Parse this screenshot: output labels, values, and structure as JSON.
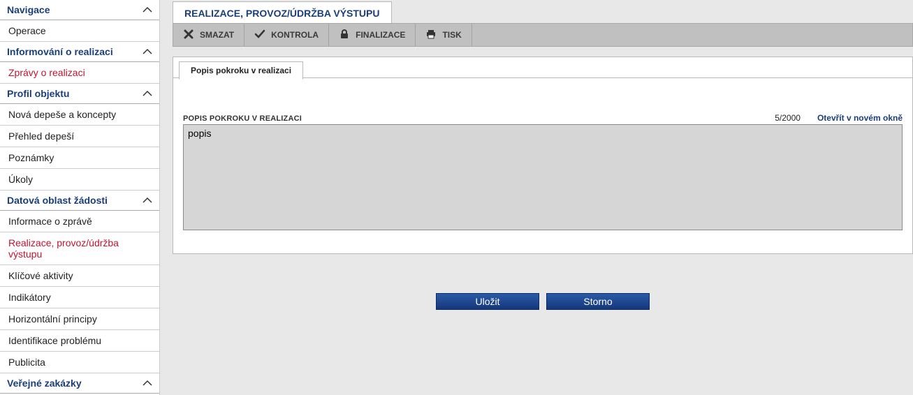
{
  "sidebar": {
    "sections": [
      {
        "header": "Navigace",
        "items": [
          {
            "label": "Operace",
            "active": false
          }
        ]
      },
      {
        "header": "Informování o realizaci",
        "items": [
          {
            "label": "Zprávy o realizaci",
            "active": true
          }
        ]
      },
      {
        "header": "Profil objektu",
        "items": [
          {
            "label": "Nová depeše a koncepty",
            "active": false
          },
          {
            "label": "Přehled depeší",
            "active": false
          },
          {
            "label": "Poznámky",
            "active": false
          },
          {
            "label": "Úkoly",
            "active": false
          }
        ]
      },
      {
        "header": "Datová oblast žádosti",
        "items": [
          {
            "label": "Informace o zprávě",
            "active": false
          },
          {
            "label": "Realizace, provoz/údržba výstupu",
            "active": true
          },
          {
            "label": "Klíčové aktivity",
            "active": false
          },
          {
            "label": "Indikátory",
            "active": false
          },
          {
            "label": "Horizontální principy",
            "active": false
          },
          {
            "label": "Identifikace problému",
            "active": false
          },
          {
            "label": "Publicita",
            "active": false
          }
        ]
      },
      {
        "header": "Veřejné zakázky",
        "items": []
      }
    ]
  },
  "page": {
    "title": "REALIZACE, PROVOZ/ÚDRŽBA VÝSTUPU"
  },
  "toolbar": {
    "delete": "SMAZAT",
    "check": "KONTROLA",
    "finalize": "FINALIZACE",
    "print": "TISK"
  },
  "form": {
    "tab_label": "Popis pokroku v realizaci",
    "field_label": "POPIS POKROKU V REALIZACI",
    "counter": "5/2000",
    "open_link": "Otevřít v novém okně",
    "value": "popis"
  },
  "buttons": {
    "save": "Uložit",
    "cancel": "Storno"
  }
}
